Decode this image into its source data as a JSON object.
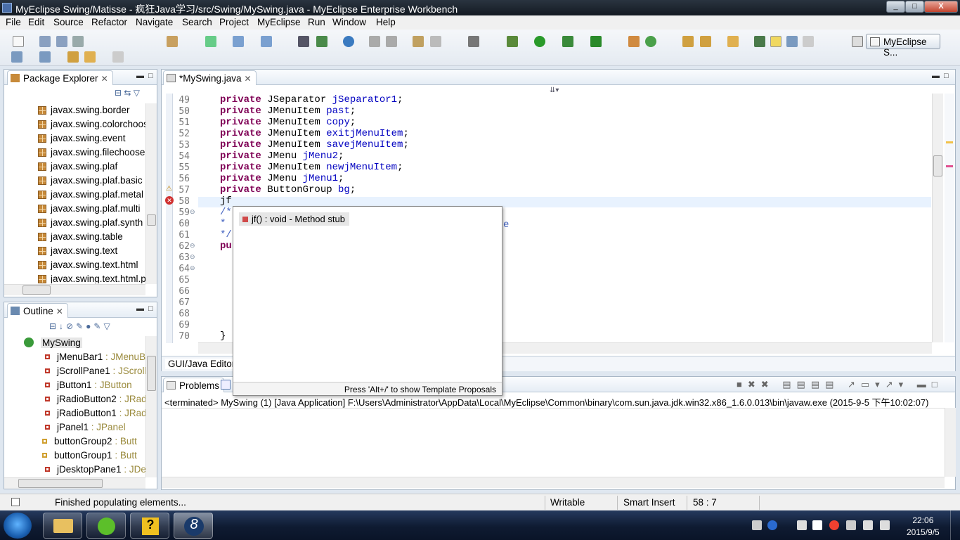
{
  "window": {
    "title": "MyEclipse Swing/Matisse - 疯狂Java学习/src/Swing/MySwing.java - MyEclipse Enterprise Workbench",
    "min": "_",
    "max": "□",
    "close": "X"
  },
  "menu": [
    "File",
    "Edit",
    "Source",
    "Refactor",
    "Navigate",
    "Search",
    "Project",
    "MyEclipse",
    "Run",
    "Window",
    "Help"
  ],
  "perspective": "MyEclipse S...",
  "package_explorer": {
    "title": "Package Explorer",
    "items": [
      "javax.swing.border",
      "javax.swing.colorchoos",
      "javax.swing.event",
      "javax.swing.filechooser",
      "javax.swing.plaf",
      "javax.swing.plaf.basic",
      "javax.swing.plaf.metal",
      "javax.swing.plaf.multi",
      "javax.swing.plaf.synth",
      "javax.swing.table",
      "javax.swing.text",
      "javax.swing.text.html",
      "javax.swing.text.html.pa"
    ]
  },
  "outline": {
    "title": "Outline",
    "root": "MySwing",
    "items": [
      {
        "name": "jMenuBar1",
        "type": " : JMenuB"
      },
      {
        "name": "jScrollPane1",
        "type": " : JScroll"
      },
      {
        "name": "jButton1",
        "type": " : JButton"
      },
      {
        "name": "jRadioButton2",
        "type": " : JRad"
      },
      {
        "name": "jRadioButton1",
        "type": " : JRad"
      },
      {
        "name": "jPanel1",
        "type": " : JPanel"
      },
      {
        "name": "buttonGroup2",
        "type": " : Butt"
      },
      {
        "name": "buttonGroup1",
        "type": " : Butt"
      },
      {
        "name": "jDesktopPane1",
        "type": " : JDe"
      }
    ]
  },
  "editor": {
    "tab": "*MySwing.java",
    "bottom_tab": "GUI/Java Editor",
    "lines": [
      {
        "n": "49",
        "kw": "private",
        "type": " JSeparator ",
        "field": "jSeparator1",
        "end": ";"
      },
      {
        "n": "50",
        "kw": "private",
        "type": " JMenuItem ",
        "field": "past",
        "end": ";"
      },
      {
        "n": "51",
        "kw": "private",
        "type": " JMenuItem ",
        "field": "copy",
        "end": ";"
      },
      {
        "n": "52",
        "kw": "private",
        "type": " JMenuItem ",
        "field": "exitjMenuItem",
        "end": ";"
      },
      {
        "n": "53",
        "kw": "private",
        "type": " JMenuItem ",
        "field": "savejMenuItem",
        "end": ";"
      },
      {
        "n": "54",
        "kw": "private",
        "type": " JMenu ",
        "field": "jMenu2",
        "end": ";"
      },
      {
        "n": "55",
        "kw": "private",
        "type": " JMenuItem ",
        "field": "newjMenuItem",
        "end": ";"
      },
      {
        "n": "56",
        "kw": "private",
        "type": " JMenu ",
        "field": "jMenu1",
        "end": ";"
      },
      {
        "n": "57",
        "kw": "private",
        "type": " ButtonGroup ",
        "field": "bg",
        "end": ";"
      },
      {
        "n": "58",
        "kw": "",
        "type": "jf",
        "field": "",
        "end": ""
      },
      {
        "n": "59",
        "kw": "",
        "type": "/*",
        "field": "",
        "end": ""
      },
      {
        "n": "60",
        "kw": "",
        "type": "*",
        "field": "",
        "end": ""
      },
      {
        "n": "61",
        "kw": "",
        "type": "*/",
        "field": "",
        "end": ""
      },
      {
        "n": "62",
        "kw": "pu",
        "type": "",
        "field": "",
        "end": ""
      },
      {
        "n": "63",
        "kw": "",
        "type": "",
        "field": "",
        "end": ""
      },
      {
        "n": "64",
        "kw": "",
        "type": "",
        "field": "",
        "end": ""
      },
      {
        "n": "65",
        "kw": "",
        "type": "",
        "field": "",
        "end": ""
      },
      {
        "n": "66",
        "kw": "",
        "type": "",
        "field": "",
        "end": ""
      },
      {
        "n": "67",
        "kw": "",
        "type": "",
        "field": "",
        "end": ""
      },
      {
        "n": "68",
        "kw": "",
        "type": "",
        "field": "",
        "end": ""
      },
      {
        "n": "69",
        "kw": "",
        "type": "",
        "field": "",
        "end": ""
      },
      {
        "n": "70",
        "kw": "",
        "type": "}",
        "field": "",
        "end": ""
      }
    ],
    "peek_char": "e"
  },
  "autocomplete": {
    "item": "jf() : void - Method stub",
    "footer": "Press 'Alt+/' to show Template Proposals"
  },
  "console": {
    "tab": "Problems",
    "text": "<terminated> MySwing (1) [Java Application] F:\\Users\\Administrator\\AppData\\Local\\MyEclipse\\Common\\binary\\com.sun.java.jdk.win32.x86_1.6.0.013\\bin\\javaw.exe (2015-9-5 下午10:02:07)"
  },
  "status": {
    "message": "Finished populating elements...",
    "writable": "Writable",
    "insert": "Smart Insert",
    "position": "58 : 7"
  },
  "taskbar": {
    "time": "22:06",
    "date": "2015/9/5"
  }
}
